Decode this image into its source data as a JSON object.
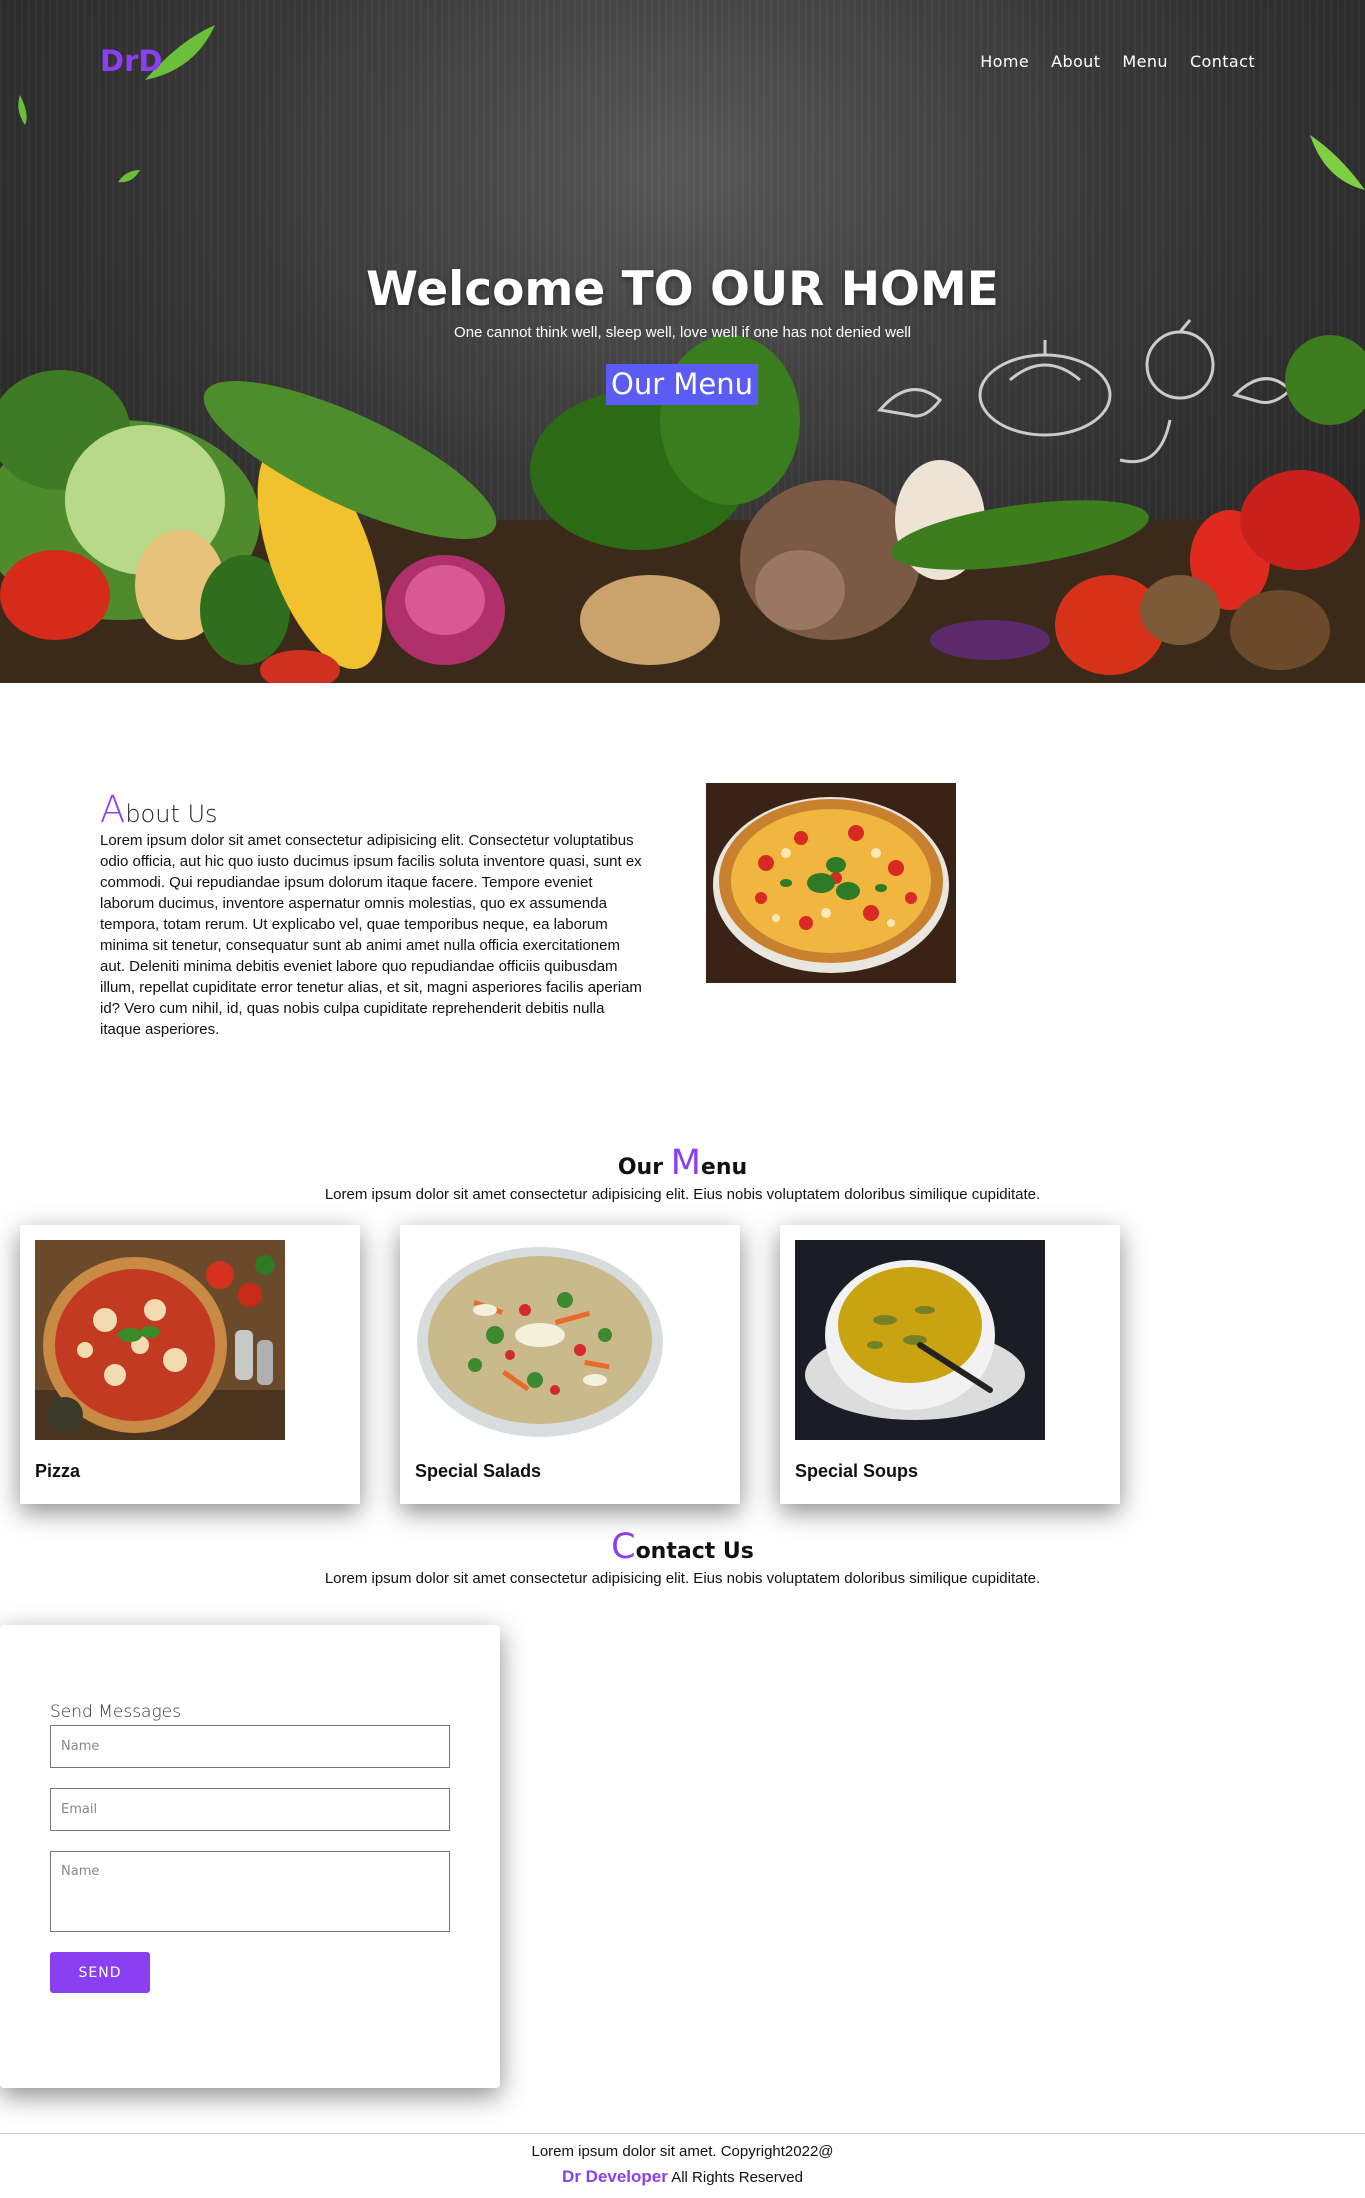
{
  "colors": {
    "accent": "#8b3ff3",
    "hero_button": "#5b5bf5",
    "hero_bg": "#3a3a3a"
  },
  "header": {
    "logo": "DrD",
    "nav": [
      "Home",
      "About",
      "Menu",
      "Contact"
    ]
  },
  "hero": {
    "title": "Welcome TO OUR HOME",
    "subtitle": "One cannot think well, sleep well, love well if one has not denied well",
    "button_label": "Our Menu"
  },
  "about": {
    "title_first": "A",
    "title_rest": "bout Us",
    "text": "Lorem ipsum dolor sit amet consectetur adipisicing elit. Consectetur voluptatibus odio officia, aut hic quo iusto ducimus ipsum facilis soluta inventore quasi, sunt ex commodi. Qui repudiandae ipsum dolorum itaque facere. Tempore eveniet laborum ducimus, inventore aspernatur omnis molestias, quo ex assumenda tempora, totam rerum. Ut explicabo vel, quae temporibus neque, ea laborum minima sit tenetur, consequatur sunt ab animi amet nulla officia exercitationem aut. Deleniti minima debitis eveniet labore quo repudiandae officiis quibusdam illum, repellat cupiditate error tenetur alias, et sit, magni asperiores facilis aperiam id? Vero cum nihil, id, quas nobis culpa cupiditate reprehenderit debitis nulla itaque asperiores.",
    "image_icon": "pizza-photo"
  },
  "menu": {
    "title_before": "Our ",
    "title_first": "M",
    "title_rest": "enu",
    "subtitle": "Lorem ipsum dolor sit amet consectetur adipisicing elit. Eius nobis voluptatem doloribus similique cupiditate.",
    "items": [
      {
        "label": "Pizza",
        "icon": "pizza-photo"
      },
      {
        "label": "Special Salads",
        "icon": "salad-photo"
      },
      {
        "label": "Special Soups",
        "icon": "soup-photo"
      }
    ]
  },
  "contact": {
    "title_first": "C",
    "title_rest": "ontact Us",
    "subtitle": "Lorem ipsum dolor sit amet consectetur adipisicing elit. Eius nobis voluptatem doloribus similique cupiditate.",
    "form_heading": "Send Messages",
    "name_placeholder": "Name",
    "email_placeholder": "Email",
    "message_placeholder": "Name",
    "send_label": "SEND"
  },
  "footer": {
    "line1": "Lorem ipsum dolor sit amet. Copyright2022@",
    "brand": "Dr Developer",
    "rights": " All Rights Reserved"
  }
}
